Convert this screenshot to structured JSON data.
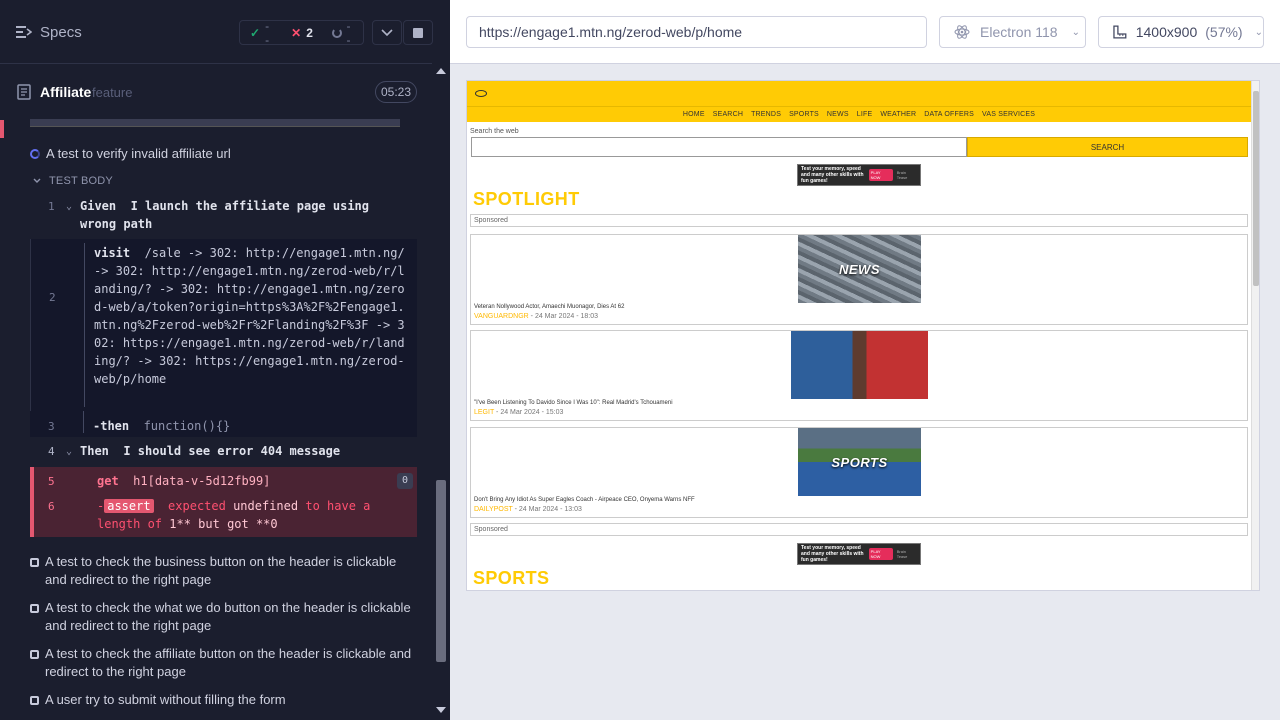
{
  "runner": {
    "specs_title": "Specs",
    "stats": {
      "passed": "--",
      "failed": "2",
      "pending": "--"
    },
    "file": {
      "name": "Affiliate",
      "ext": "feature",
      "duration": "05:23"
    },
    "test": {
      "title": "A test to verify invalid affiliate url",
      "body_label": "TEST BODY",
      "commands": [
        {
          "num": "1",
          "keyword": "Given",
          "text": "I launch the affiliate page using wrong path"
        },
        {
          "num": "2",
          "keyword": "visit",
          "text": "/sale -> 302: http://engage1.mtn.ng/ -> 302: http://engage1.mtn.ng/zerod-web/r/landing/? -> 302: http://engage1.mtn.ng/zerod-web/a/token?origin=https%3A%2F%2Fengage1.mtn.ng%2Fzerod-web%2Fr%2Flanding%2F%3F -> 302: https://engage1.mtn.ng/zerod-web/r/landing/? -> 302: https://engage1.mtn.ng/zerod-web/p/home"
        },
        {
          "num": "3",
          "keyword": "-then",
          "text": "function(){}"
        },
        {
          "num": "4",
          "keyword": "Then",
          "text": "I should see error 404 message"
        },
        {
          "num": "5",
          "keyword": "get",
          "text": "h1[data-v-5d12fb99]",
          "badge": "0"
        },
        {
          "num": "6",
          "prefix": "-",
          "chip": "assert",
          "p1": "expected",
          "p2": "undefined",
          "p3": "to have a length of",
          "p4": "1** but got **0"
        }
      ]
    },
    "other_tests": [
      "A test to check the business button on the header is clickable and redirect to the right page",
      "A test to check the what we do button on the header is clickable and redirect to the right page",
      "A test to check the affiliate button on the header is clickable and redirect to the right page",
      "A user try to submit without filling the form"
    ]
  },
  "browser": {
    "url": "https://engage1.mtn.ng/zerod-web/p/home",
    "browser_name": "Electron 118",
    "viewport": "1400x900",
    "zoom": "(57%)"
  },
  "site": {
    "nav": [
      "HOME",
      "SEARCH",
      "TRENDS",
      "SPORTS",
      "NEWS",
      "LIFE",
      "WEATHER",
      "DATA OFFERS",
      "VAS SERVICES"
    ],
    "search_label": "Search the web",
    "search_button": "SEARCH",
    "ad": {
      "text": "Test your memory, speed and many other skills with fun games!",
      "tag": "1st day free",
      "cta": "PLAY NOW",
      "brand": "Brain Tease"
    },
    "spotlight_heading": "SPOTLIGHT",
    "sponsored_label": "Sponsored",
    "sports_heading": "SPORTS",
    "cards": [
      {
        "thumb_label": "NEWS",
        "headline": "Veteran Nollywood Actor, Amaechi Muonagor, Dies At 62",
        "source": "VANGUARDNGR",
        "meta": " - 24 Mar 2024 - 18:03"
      },
      {
        "thumb_label": "",
        "headline": "\"I've Been Listening To Davido Since I Was 10\": Real Madrid's Tchouameni",
        "source": "LEGIT",
        "meta": " - 24 Mar 2024 - 15:03"
      },
      {
        "thumb_label": "SPORTS",
        "headline": "Don't Bring Any Idiot As Super Eagles Coach - Airpeace CEO, Onyema Warns NFF",
        "source": "DAILYPOST",
        "meta": " - 24 Mar 2024 - 13:03"
      }
    ]
  },
  "colors": {
    "pass": "#1fa971",
    "fail": "#ff5070",
    "mtn_yellow": "#ffcb05",
    "runner_bg": "#1b1e2e"
  }
}
